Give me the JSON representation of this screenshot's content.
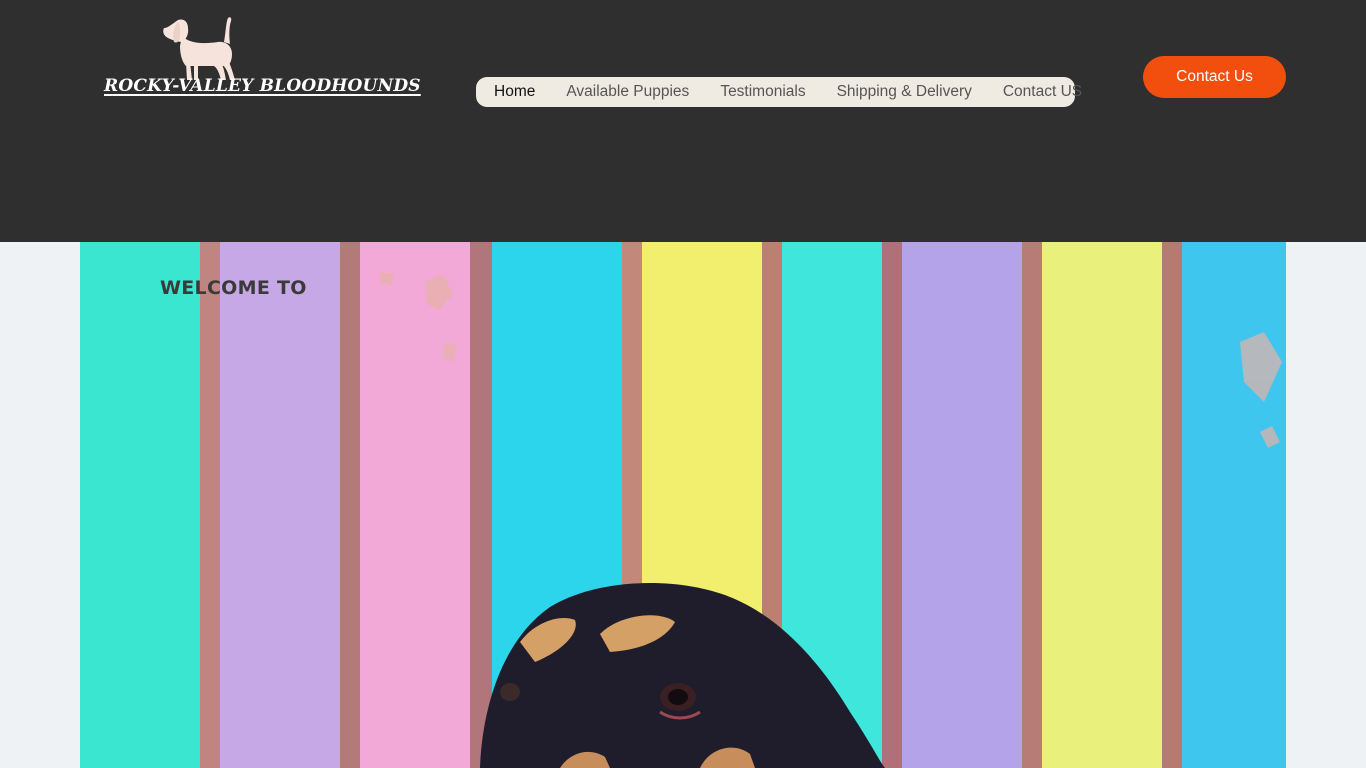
{
  "brand": {
    "name": "ROCKY-VALLEY BLOODHOUNDS",
    "logo_icon": "dog-silhouette-icon"
  },
  "nav": {
    "items": [
      {
        "label": "Home",
        "active": true
      },
      {
        "label": "Available Puppies",
        "active": false
      },
      {
        "label": "Testimonials",
        "active": false
      },
      {
        "label": "Shipping & Delivery",
        "active": false
      },
      {
        "label": "Contact US",
        "active": false
      }
    ]
  },
  "cta": {
    "label": "Contact Us",
    "color": "#f24f0e"
  },
  "hero": {
    "heading": "WELCOME TO",
    "image": "bloodhound-puppy-photo"
  },
  "colors": {
    "header_bg": "#2f2f2f",
    "page_bg": "#eef2f5",
    "nav_bg": "#efebe2"
  }
}
